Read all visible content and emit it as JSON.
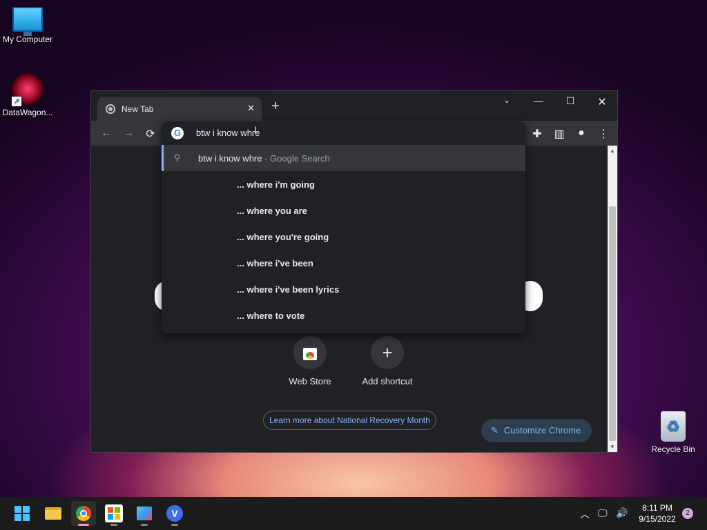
{
  "desktop": {
    "icons": [
      {
        "label": "My Computer",
        "icon": "monitor-icon"
      },
      {
        "label": "DataWagon...",
        "icon": "mandala-app-icon"
      },
      {
        "label": "Recycle Bin",
        "icon": "recycle-bin-icon"
      }
    ]
  },
  "browser": {
    "tab_title": "New Tab",
    "tab_close": "✕",
    "new_tab": "+",
    "window_controls": {
      "tab_search": "⌄",
      "minimize": "—",
      "maximize": "☐",
      "close": "✕"
    },
    "toolbar": {
      "back": "←",
      "forward": "→",
      "reload": "⟳",
      "extensions": "✚",
      "side_panel": "▥",
      "profile": "●",
      "menu": "⋮"
    },
    "omnibox": {
      "input_value": "btw i know whre",
      "top_suggestion": {
        "query": "btw i know whre",
        "hint": " - Google Search"
      },
      "suggestions_prefix": "...",
      "suggestions": [
        "where i'm going",
        "where you are",
        "where you're going",
        "where i've been",
        "where i've been lyrics",
        "where to vote"
      ]
    },
    "ntp": {
      "shortcuts": [
        {
          "label": "Web Store",
          "icon": "web-store-icon"
        },
        {
          "label": "Add shortcut",
          "icon": "plus-icon",
          "glyph": "+"
        }
      ],
      "promo_link": "Learn more about National Recovery Month",
      "customize_label": "Customize Chrome",
      "customize_icon": "✎"
    }
  },
  "taskbar": {
    "apps": [
      "start",
      "file-explorer",
      "chrome",
      "microsoft-store",
      "app",
      "vpn"
    ],
    "vpn_letter": "V",
    "tray": {
      "chevron": "︿",
      "network": "🖵",
      "volume": "🔊"
    },
    "time": "8:11 PM",
    "date": "9/15/2022",
    "notification_count": "2"
  },
  "colors": {
    "accent": "#8ab4f8",
    "window_bg": "#202124",
    "toolbar_bg": "#35363a"
  }
}
